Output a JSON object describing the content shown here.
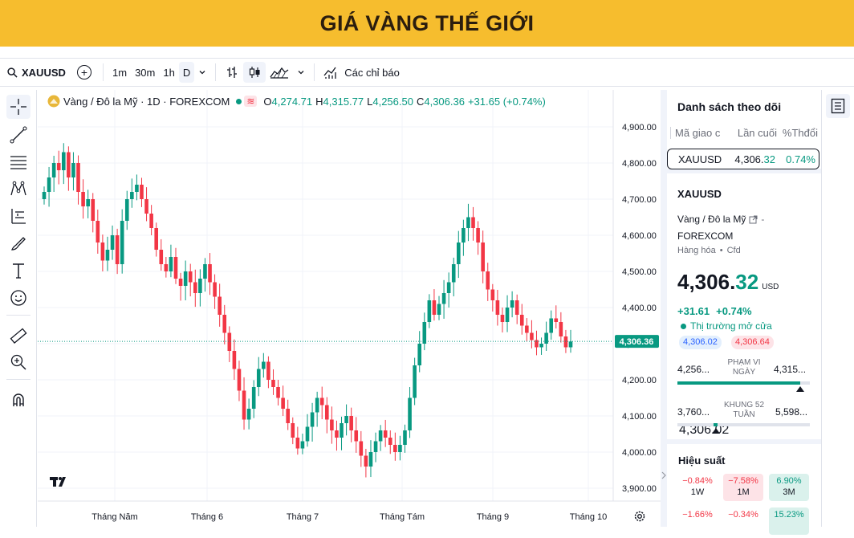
{
  "banner": {
    "title": "GIÁ VÀNG THẾ GIỚI"
  },
  "toolbar": {
    "symbol": "XAUUSD",
    "intervals": [
      "1m",
      "30m",
      "1h",
      "D"
    ],
    "indicators_label": "Các chỉ báo"
  },
  "legend": {
    "symbol_desc": "Vàng / Đô la Mỹ · 1D · FOREXCOM",
    "wave": "≋",
    "o_key": "O",
    "o_val": "4,274.71",
    "h_key": "H",
    "h_val": "4,315.77",
    "l_key": "L",
    "l_val": "4,256.50",
    "c_key": "C",
    "c_val": "4,306.36",
    "change": "+31.65 (+0.74%)"
  },
  "chart_data": {
    "type": "candlestick",
    "y_ticks": [
      "4,900.00",
      "4,800.00",
      "4,700.00",
      "4,600.00",
      "4,500.00",
      "4,400.00",
      "4,300.00",
      "4,200.00",
      "4,100.00",
      "4,000.00",
      "3,900.00"
    ],
    "ylim": [
      3880,
      4930
    ],
    "x_ticks": [
      "Tháng Năm",
      "Tháng 6",
      "Tháng 7",
      "Tháng Tám",
      "Tháng 9",
      "Tháng 10"
    ],
    "last_price_label": "4,306.36",
    "last_price": 4306.36,
    "up_color": "#089981",
    "down_color": "#f23645",
    "closes": [
      4720,
      4760,
      4800,
      4780,
      4830,
      4760,
      4800,
      4720,
      4680,
      4700,
      4640,
      4580,
      4530,
      4560,
      4600,
      4520,
      4640,
      4700,
      4720,
      4740,
      4700,
      4660,
      4620,
      4560,
      4520,
      4500,
      4540,
      4480,
      4460,
      4500,
      4470,
      4440,
      4480,
      4520,
      4470,
      4430,
      4380,
      4330,
      4280,
      4230,
      4170,
      4090,
      4120,
      4180,
      4230,
      4250,
      4200,
      4180,
      4150,
      4120,
      4080,
      4040,
      4010,
      4030,
      4070,
      4110,
      4150,
      4130,
      4090,
      4060,
      4040,
      4080,
      4100,
      4060,
      4030,
      3990,
      3960,
      4000,
      4030,
      4060,
      4040,
      4020,
      4000,
      4020,
      4060,
      4150,
      4240,
      4300,
      4360,
      4420,
      4380,
      4410,
      4440,
      4470,
      4520,
      4580,
      4620,
      4650,
      4620,
      4580,
      4500,
      4450,
      4420,
      4380,
      4360,
      4400,
      4420,
      4380,
      4350,
      4330,
      4310,
      4290,
      4300,
      4330,
      4370,
      4360,
      4320,
      4290,
      4306
    ]
  },
  "watchlist": {
    "title": "Danh sách theo dõi",
    "columns": [
      "Mã giao c",
      "Lần cuối",
      "%Thđổi"
    ],
    "row": {
      "symbol": "XAUUSD",
      "last_main": "4,306.",
      "last_dec": "32",
      "change": "0.74%"
    }
  },
  "detail": {
    "symbol": "XAUUSD",
    "desc": "Vàng / Đô la Mỹ",
    "exchange": "FOREXCOM",
    "category": "Hàng hóa",
    "type": "Cfd",
    "price_main": "4,306.",
    "price_dec": "32",
    "currency": "USD",
    "change": "+31.61",
    "change_pct": "+0.74%",
    "market_status": "Thị trường mở cửa",
    "bid": "4,306.02",
    "ask": "4,306.64",
    "day_low": "4,256...",
    "day_high": "4,315...",
    "day_range_label": "PHẠM VI NGÀY",
    "day_range_pos": 0.93,
    "week_low": "3,760...",
    "week_high": "5,598...",
    "week_range_label": "KHUNG 52 TUẦN",
    "week_range_pos": 0.29,
    "perf_title": "Hiệu suất",
    "perf": [
      {
        "value": "−0.84%",
        "label": "1W",
        "dir": "down"
      },
      {
        "value": "−7.58%",
        "label": "1M",
        "dir": "down"
      },
      {
        "value": "6.90%",
        "label": "3M",
        "dir": "up"
      },
      {
        "value": "−1.66%",
        "label": "",
        "dir": "down"
      },
      {
        "value": "−0.34%",
        "label": "",
        "dir": "down"
      },
      {
        "value": "15.23%",
        "label": "",
        "dir": "up"
      }
    ]
  }
}
